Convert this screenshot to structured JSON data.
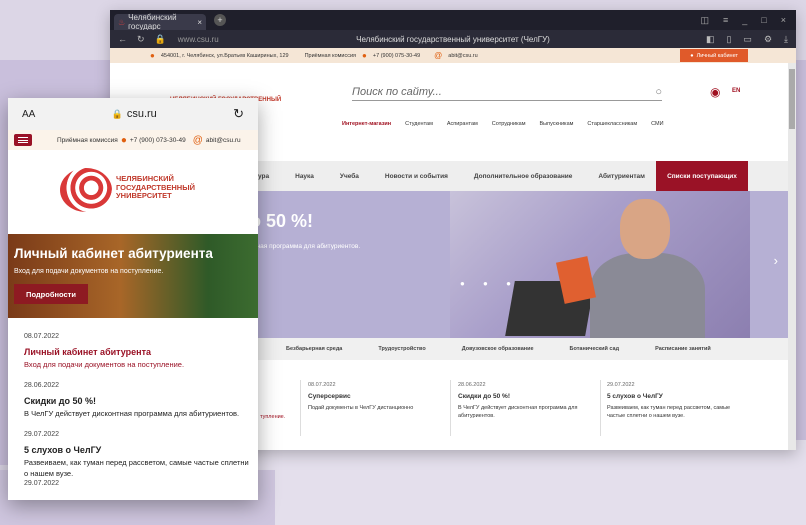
{
  "desktop": {
    "tab_title": "Челябинский государс",
    "window_title": "Челябинский государственный университет (ЧелГУ)",
    "url": "www.csu.ru",
    "address": "454001, г. Челябинск, ул.Братьев Кашириных, 129",
    "admission_label": "Приёмная комиссия",
    "phone": "+7 (900) 075-30-49",
    "email": "abit@csu.ru",
    "personal_account": "Личный кабинет",
    "logo_text": "ЧЕЛЯБИНСКИЙ ГОСУДАРСТВЕННЫЙ",
    "search_placeholder": "Поиск по сайту...",
    "lang": "EN",
    "top_nav": [
      "Интернет-магазин",
      "Студентам",
      "Аспирантам",
      "Сотрудникам",
      "Выпускникам",
      "Старшеклассникам",
      "СМИ"
    ],
    "main_nav": [
      "ура",
      "Наука",
      "Учеба",
      "Новости и события",
      "Дополнительное образование",
      "Абитуриентам"
    ],
    "main_nav_button": "Списки поступающих",
    "hero_title": "о 50 %!",
    "hero_subtitle": "нтная программа для абитуриентов.",
    "sub_nav": [
      "Безбарьерная среда",
      "Трудоустройство",
      "Довузовское образование",
      "Ботанический сад",
      "Расписание занятий"
    ],
    "news_partial": "тупление.",
    "news": [
      {
        "date": "08.07.2022",
        "title": "Суперсервис",
        "text": "Подай документы в ЧелГУ дистанционно"
      },
      {
        "date": "28.06.2022",
        "title": "Скидки до 50 %!",
        "text": "В ЧелГУ действует дисконтная программа для абитуриентов."
      },
      {
        "date": "29.07.2022",
        "title": "5 слухов о ЧелГУ",
        "text": "Развеиваем, как туман перед рассветом, самые частые сплетни о нашем вузе."
      }
    ]
  },
  "mobile": {
    "aa": "AA",
    "domain": "csu.ru",
    "admission_label": "Приёмная комиссия",
    "phone": "+7 (900) 073-30-49",
    "email": "abit@csu.ru",
    "logo_line1": "ЧЕЛЯБИНСКИЙ",
    "logo_line2": "ГОСУДАРСТВЕННЫЙ",
    "logo_line3": "УНИВЕРСИТЕТ",
    "hero_title": "Личный кабинет абитуриента",
    "hero_subtitle": "Вход для подачи документов на поступление.",
    "hero_button": "Подробности",
    "news": [
      {
        "date": "08.07.2022",
        "title": "Личный кабинет абитурента",
        "text": "Вход для подачи документов на поступление.",
        "red": true
      },
      {
        "date": "28.06.2022",
        "title": "Скидки до 50 %!",
        "text": "В ЧелГУ действует дисконтная программа для абитуриентов.",
        "red": false
      },
      {
        "date": "29.07.2022",
        "title": "5 слухов о ЧелГУ",
        "text": "Развеиваем, как туман перед рассветом, самые частые сплетни о нашем вузе.",
        "red": false
      }
    ],
    "trailing_date": "29.07.2022"
  },
  "colors": {
    "brand": "#9a1226",
    "accent": "#e05a2a",
    "nav_bg": "#eeeeee"
  }
}
